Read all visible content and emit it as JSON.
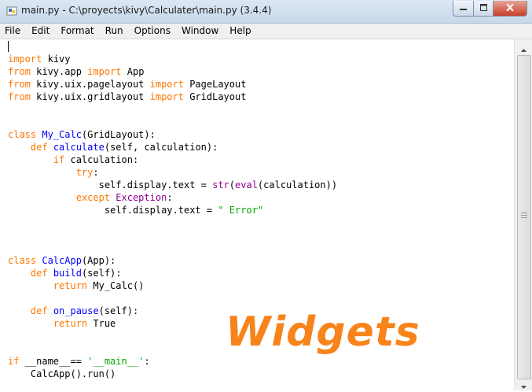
{
  "window": {
    "title": "main.py - C:\\proyects\\kivy\\Calculater\\main.py (3.4.4)",
    "icon": "idle-python-icon",
    "controls": {
      "minimize": "minimize-icon",
      "maximize": "maximize-icon",
      "close": "close-icon"
    }
  },
  "menu": {
    "file": "File",
    "edit": "Edit",
    "format": "Format",
    "run": "Run",
    "options": "Options",
    "window": "Window",
    "help": "Help"
  },
  "code": {
    "l1": {
      "a": "import",
      "b": " kivy"
    },
    "l2": {
      "a": "from",
      "b": " kivy.app ",
      "c": "import",
      "d": " App"
    },
    "l3": {
      "a": "from",
      "b": " kivy.uix.pagelayout ",
      "c": "import",
      "d": " PageLayout"
    },
    "l4": {
      "a": "from",
      "b": " kivy.uix.gridlayout ",
      "c": "import",
      "d": " GridLayout"
    },
    "l7": {
      "a": "class",
      "b": " ",
      "c": "My_Calc",
      "d": "(GridLayout):"
    },
    "l8": {
      "a": "    def",
      "b": " ",
      "c": "calculate",
      "d": "(self, calculation):"
    },
    "l9": {
      "a": "        if",
      "b": " calculation:"
    },
    "l10": {
      "a": "            try",
      "b": ":"
    },
    "l11": {
      "a": "                self.display.text = ",
      "b": "str",
      "c": "(",
      "d": "eval",
      "e": "(calculation))"
    },
    "l12": {
      "a": "            except",
      "b": " ",
      "c": "Exception",
      "d": ":"
    },
    "l13": {
      "a": "                 self.display.text = ",
      "b": "\" Error\""
    },
    "l17": {
      "a": "class",
      "b": " ",
      "c": "CalcApp",
      "d": "(App):"
    },
    "l18": {
      "a": "    def",
      "b": " ",
      "c": "build",
      "d": "(self):"
    },
    "l19": {
      "a": "        return",
      "b": " My_Calc()"
    },
    "l21": {
      "a": "    def",
      "b": " ",
      "c": "on_pause",
      "d": "(self):"
    },
    "l22": {
      "a": "        return",
      "b": " True"
    },
    "l25": {
      "a": "if",
      "b": " __name__== ",
      "c": "'__main__'",
      "d": ":"
    },
    "l26": {
      "a": "    CalcApp().run()"
    }
  },
  "overlay": {
    "text": "Widgets"
  },
  "colors": {
    "keyword": "#ff7700",
    "definition": "#0000ff",
    "builtin": "#900090",
    "string": "#00aa00",
    "overlay": "#f7841b"
  }
}
